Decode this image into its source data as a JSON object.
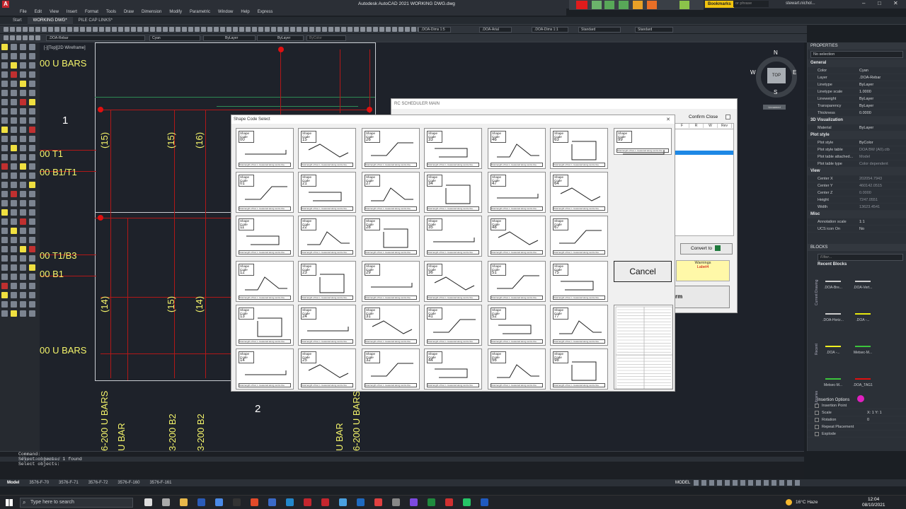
{
  "app": {
    "title": "Autodesk AutoCAD 2021   WORKING DWG.dwg",
    "search_placeholder": "or phrase",
    "user": "stewart.nichol...",
    "bookmarks": "Bookmarks"
  },
  "menu": [
    "File",
    "Edit",
    "View",
    "Insert",
    "Format",
    "Tools",
    "Draw",
    "Dimension",
    "Modify",
    "Parametric",
    "Window",
    "Help",
    "Express"
  ],
  "doc_tabs": [
    "Start",
    "WORKING DWG*",
    "PILE CAP LINKS*"
  ],
  "ribbon": {
    "dim_style": ".DOA-Dims 1:5",
    "text_style": ".DOA-Arial",
    "dim_style2": ".DOA-Dims 1:1",
    "table_style": "Standard",
    "mleader_style": "Standard",
    "layer": ".DOA-Rebar",
    "color": "Cyan",
    "linetype": "ByLayer",
    "lineweight": "ByLayer",
    "plotstyle": "ByColor"
  },
  "viewport_label": "[-][Top][2D Wireframe]",
  "canvas_text": {
    "u_bars_top": "00 U BARS",
    "t1": "00 T1",
    "b1t1": "00 B1/T1",
    "t1b3": "00 T1/B3",
    "b1": "00 B1",
    "u_bars_bot": "00 U BARS",
    "num1": "1",
    "num2": "2",
    "n15a": "(15)",
    "n15b": "(15)",
    "n16": "(16)",
    "n14a": "(14)",
    "n15c": "(15)",
    "n14b": "(14)",
    "v1": "6-200 U BARS",
    "v2": "U BAR",
    "v3": "3-200 B2",
    "v4": "3-200 B2",
    "v5": "U BAR",
    "v6": "6-200 U BARS"
  },
  "compass": {
    "n": "N",
    "s": "S",
    "e": "E",
    "w": "W",
    "top": "TOP",
    "ucs": "Unnamed"
  },
  "rc_main": {
    "title": "RC SCHEDULER MAIN",
    "confirm_close": "Confirm Close",
    "cols": [
      "F",
      "R",
      "W",
      "Rev"
    ],
    "convert": "Convert to",
    "warnings": "Warnings",
    "label": "Label4",
    "form_btn": "rm"
  },
  "dialog": {
    "title": "Shape Code Select",
    "cancel": "Cancel",
    "shape_label": "Shape Code",
    "caption": "Total length of bar, L measured along centre line.",
    "codes": [
      "00",
      "15",
      "26",
      "33",
      "46",
      "63",
      "99",
      "01",
      "21",
      "27",
      "34",
      "47",
      "64",
      "11",
      "22",
      "28",
      "35",
      "48",
      "67",
      "12",
      "23",
      "29",
      "36",
      "51",
      "75",
      "13",
      "24",
      "31",
      "41",
      "52",
      "77",
      "14",
      "25",
      "32",
      "44",
      "56",
      "98"
    ]
  },
  "properties": {
    "header": "PROPERTIES",
    "selection": "No selection",
    "general": "General",
    "rows_general": [
      {
        "k": "Color",
        "v": "Cyan"
      },
      {
        "k": "Layer",
        "v": ".DOA-Rebar"
      },
      {
        "k": "Linetype",
        "v": "ByLayer"
      },
      {
        "k": "Linetype scale",
        "v": "1.0000"
      },
      {
        "k": "Lineweight",
        "v": "ByLayer"
      },
      {
        "k": "Transparency",
        "v": "ByLayer"
      },
      {
        "k": "Thickness",
        "v": "0.0000"
      }
    ],
    "viz": "3D Visualization",
    "rows_viz": [
      {
        "k": "Material",
        "v": "ByLayer"
      }
    ],
    "plot": "Plot style",
    "rows_plot": [
      {
        "k": "Plot style",
        "v": "ByColor"
      },
      {
        "k": "Plot style table",
        "v": "DOA BW (A0).ctb"
      },
      {
        "k": "Plot table attached...",
        "v": "Model"
      },
      {
        "k": "Plot table type",
        "v": "Color dependent"
      }
    ],
    "view": "View",
    "rows_view": [
      {
        "k": "Center X",
        "v": "202054.7943"
      },
      {
        "k": "Center Y",
        "v": "460142.0515"
      },
      {
        "k": "Center Z",
        "v": "0.0000"
      },
      {
        "k": "Height",
        "v": "7247.0551"
      },
      {
        "k": "Width",
        "v": "13623.4541"
      }
    ],
    "misc": "Misc",
    "rows_misc": [
      {
        "k": "Annotation scale",
        "v": "1:1"
      },
      {
        "k": "UCS icon On",
        "v": "No"
      }
    ],
    "blocks": "BLOCKS",
    "filter": "Filter...",
    "recent": "Recent Blocks",
    "block_items": [
      ".DOA-Bre...",
      ".DOA-Vert...",
      ".DOA-Horiz...",
      ".DOA -...",
      ".DOA -...",
      "Metsec-M...",
      "Metsec-M...",
      ".DOA_TAG1"
    ],
    "side_tabs": [
      "Current Drawing",
      "Recent",
      "Libraries"
    ],
    "insert_opts": "Insertion Options",
    "opts": [
      {
        "k": "Insertion Point",
        "v": ""
      },
      {
        "k": "Scale",
        "v": "X: 1  Y: 1"
      },
      {
        "k": "Rotation",
        "v": "0"
      },
      {
        "k": "Repeat Placement",
        "v": ""
      },
      {
        "k": "Explode",
        "v": ""
      }
    ]
  },
  "command": {
    "lines": [
      "Command:",
      "Select objects: 1 found",
      "Select objects:"
    ],
    "placeholder": "Type a command"
  },
  "status_tabs": [
    "Model",
    "3576-F-70",
    "3576-F-71",
    "3576-F-72",
    "3576-F-160",
    "3576-F-161"
  ],
  "status_right": "MODEL",
  "taskbar": {
    "search": "Type here to search",
    "weather": "16°C  Haze",
    "time": "12:04",
    "date": "08/10/2021"
  }
}
